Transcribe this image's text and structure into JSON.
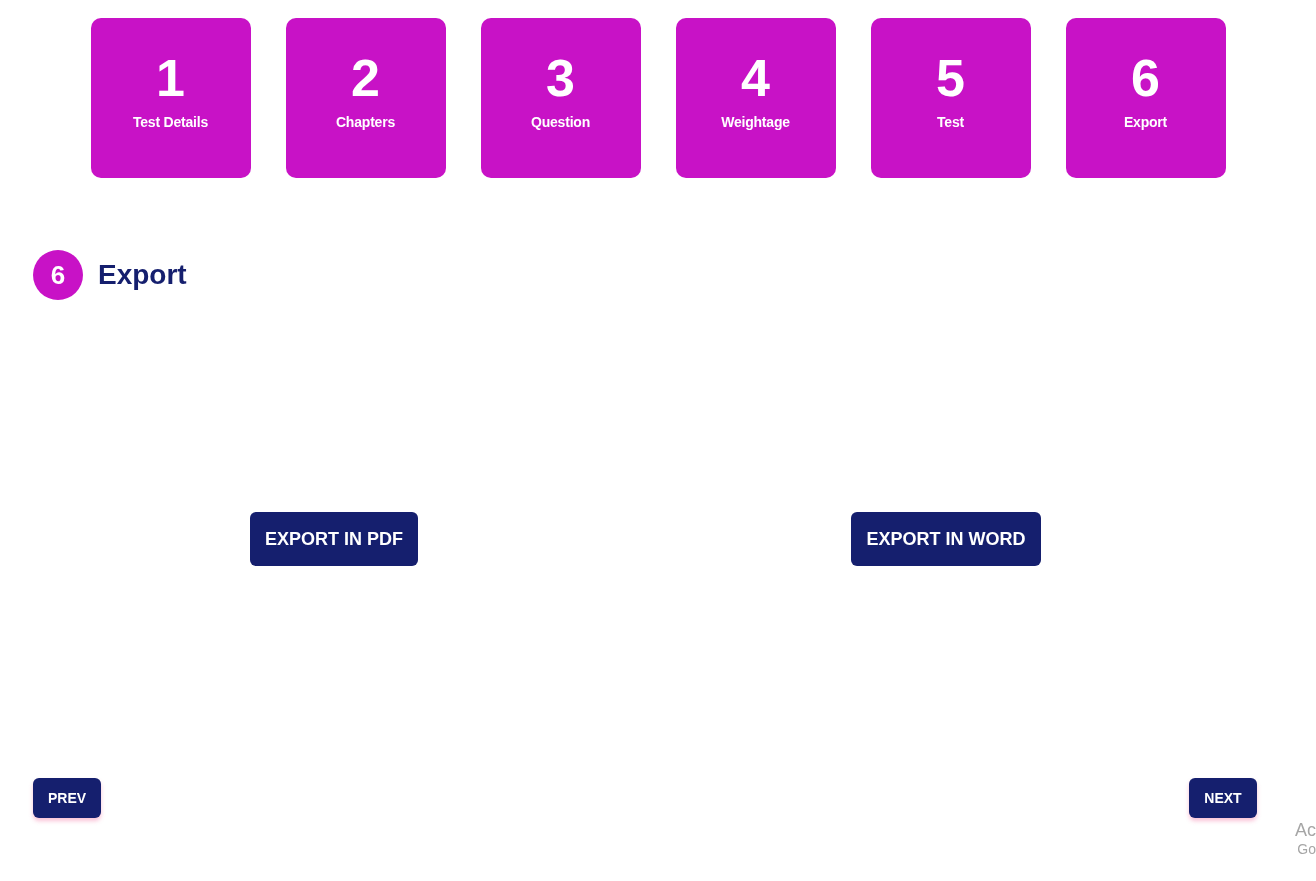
{
  "steps": [
    {
      "number": "1",
      "label": "Test Details"
    },
    {
      "number": "2",
      "label": "Chapters"
    },
    {
      "number": "3",
      "label": "Question"
    },
    {
      "number": "4",
      "label": "Weightage"
    },
    {
      "number": "5",
      "label": "Test"
    },
    {
      "number": "6",
      "label": "Export"
    }
  ],
  "section": {
    "number": "6",
    "title": "Export"
  },
  "export_buttons": [
    "EXPORT IN PDF",
    "EXPORT IN WORD"
  ],
  "navigation": {
    "prev": "PREV",
    "next": "NEXT"
  },
  "system_notice": {
    "line_1": "Ac",
    "line_2": "Go"
  }
}
